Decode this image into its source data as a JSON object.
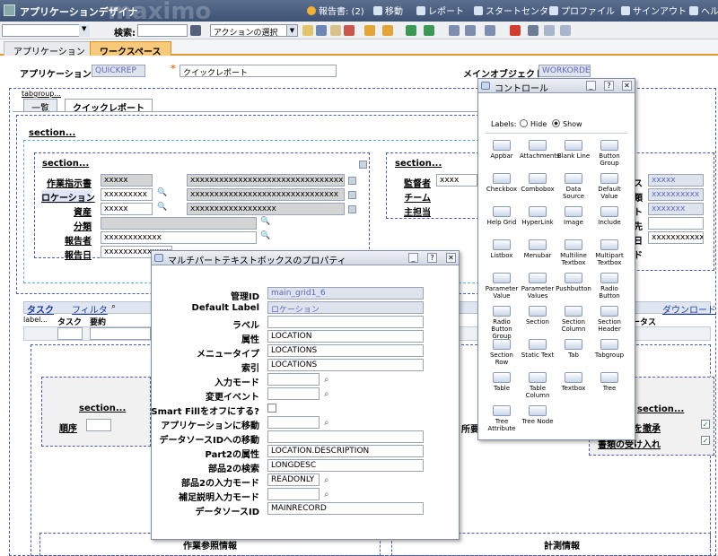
{
  "window": {
    "app_title": "アプリケーションデザイナ",
    "logo": "maximo",
    "nav": {
      "bulletin": "報告書: (2)",
      "goto": "移動",
      "reports": "レポート",
      "start_center": "スタートセンタ",
      "profile": "プロファイル",
      "signout": "サインアウト",
      "help": "ヘルプ"
    }
  },
  "toolbar": {
    "search_label": "検索:",
    "action_select": "アクションの選択"
  },
  "app_tabs": [
    "アプリケーション",
    "ワークスペース"
  ],
  "header": {
    "app_label": "アプリケーション",
    "app_value": "QUICKREP",
    "desc_value": "クイックレポート",
    "main_object_label": "メインオブジェクト",
    "main_object_value": "WORKORDER"
  },
  "canvas": {
    "tabgroup": "tabgroup...",
    "tabs": [
      "一覧",
      "クイックレポート"
    ],
    "section": "section...",
    "left_fields": [
      {
        "label": "作業指示書",
        "v1": "xxxxx",
        "v2": "xxxxxxxxxxxxxxxxxxxxxxxxxxxxxxxxx"
      },
      {
        "label": "ロケーション",
        "v1": "xxxxxxxxx",
        "v2": "xxxxxxxxxxxxxxxxxxxxxxxxxxxxxxx"
      },
      {
        "label": "資産",
        "v1": "xxxxx",
        "v2": "xxxxxxxxxxxxxxxxxx"
      },
      {
        "label": "分類",
        "v1": "",
        "v2": ""
      },
      {
        "label": "報告者",
        "v1": "xxxxxxxxxxxx",
        "v2": ""
      },
      {
        "label": "報告日",
        "v1": "xxxxxxxxxxxxxx",
        "v2": ""
      }
    ],
    "right_fields": [
      {
        "label": "監督者",
        "v1": "xxxx"
      },
      {
        "label": "チーム",
        "v1": ""
      },
      {
        "label": "主担当",
        "v1": ""
      }
    ],
    "far_right": {
      "l1": "ス",
      "v1": "xxxxx",
      "l2": "類",
      "v2": "xxxxxxxxxx",
      "l3": "ト",
      "v3": "xxxxxxx",
      "l4": "先",
      "v4": "",
      "l5": "日",
      "v5": "xxxxxxxxxxxxx",
      "l6": "ド",
      "v6": ""
    },
    "task_band": {
      "title": "タスク",
      "filter": "フィルタ",
      "col_label": "label...",
      "col_task": "タスク",
      "col_summary": "要約",
      "status_col": "ータス",
      "download": "ダウンロード"
    },
    "bottom": {
      "section1": "section...",
      "seq_label": "順序",
      "section2": "section...",
      "owner_label": "所要",
      "check1": "スの変更を撤承",
      "check2": "書類の受け入れ",
      "info1": "作業参照情報",
      "info2": "計測情報"
    }
  },
  "properties_dialog": {
    "title": "マルチパートテキストボックスのプロパティ",
    "rows": [
      {
        "label": "管理ID",
        "value": "main_grid1_6",
        "readonly": true
      },
      {
        "label": "Default Label",
        "value": "ロケーション",
        "readonly": true
      },
      {
        "label": "ラベル",
        "value": ""
      },
      {
        "label": "属性",
        "value": "LOCATION"
      },
      {
        "label": "メニュータイプ",
        "value": "LOCATIONS"
      },
      {
        "label": "索引",
        "value": "LOCATIONS"
      },
      {
        "label": "入力モード",
        "value": "",
        "lookup": true
      },
      {
        "label": "変更イベント",
        "value": "",
        "lookup": true
      },
      {
        "label": "Smart Fillをオフにする?",
        "checkbox": true
      },
      {
        "label": "アプリケーションに移動",
        "value": "",
        "lookup": true
      },
      {
        "label": "データソースIDへの移動",
        "value": ""
      },
      {
        "label": "Part2の属性",
        "value": "LOCATION.DESCRIPTION"
      },
      {
        "label": "部品2の検索",
        "value": "LONGDESC"
      },
      {
        "label": "部品2の入力モード",
        "value": "READONLY",
        "lookup": true
      },
      {
        "label": "補足説明入力モード",
        "value": "",
        "lookup": true
      },
      {
        "label": "データソースID",
        "value": "MAINRECORD"
      }
    ]
  },
  "controls_dialog": {
    "title": "コントロール",
    "labels_text": "Labels:",
    "hide": "Hide",
    "show": "Show",
    "controls": [
      "Appbar",
      "Attachments",
      "Blank Line",
      "Button Group",
      "Checkbox",
      "Combobox",
      "Data Source",
      "Default Value",
      "Help Grid",
      "HyperLink",
      "Image",
      "Include",
      "Listbox",
      "Menubar",
      "Multiline Textbox",
      "Multipart Textbox",
      "Parameter Value",
      "Parameter Values",
      "Pushbutton",
      "Radio Button",
      "Radio Button Group",
      "Section",
      "Section Column",
      "Section Header",
      "Section Row",
      "Static Text",
      "Tab",
      "Tabgroup",
      "Table",
      "Table Column",
      "Textbox",
      "Tree",
      "Tree Attribute",
      "Tree Node"
    ]
  }
}
